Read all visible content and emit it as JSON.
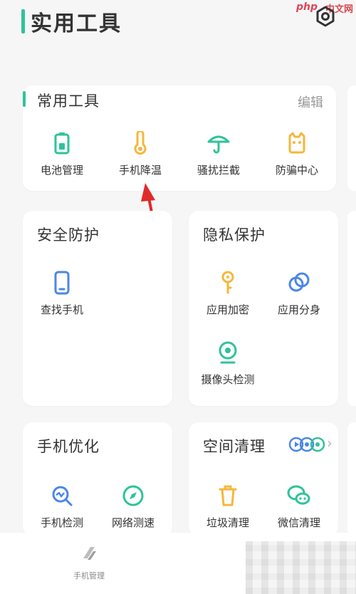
{
  "header": {
    "title": "实用工具",
    "watermark_php": "php",
    "watermark_cn": "中文网"
  },
  "common_tools": {
    "title": "常用工具",
    "edit_label": "编辑",
    "items": [
      {
        "label": "电池管理",
        "icon": "battery-icon"
      },
      {
        "label": "手机降温",
        "icon": "thermometer-icon"
      },
      {
        "label": "骚扰拦截",
        "icon": "umbrella-icon"
      },
      {
        "label": "防骗中心",
        "icon": "shield-face-icon"
      }
    ]
  },
  "security": {
    "title": "安全防护",
    "items": [
      {
        "label": "查找手机",
        "icon": "phone-icon"
      }
    ]
  },
  "privacy": {
    "title": "隐私保护",
    "items": [
      {
        "label": "应用加密",
        "icon": "key-icon"
      },
      {
        "label": "应用分身",
        "icon": "clone-icon"
      },
      {
        "label": "摄像头检测",
        "icon": "camera-icon"
      }
    ]
  },
  "optimize": {
    "title": "手机优化",
    "items": [
      {
        "label": "手机检测",
        "icon": "scan-icon"
      },
      {
        "label": "网络测速",
        "icon": "compass-icon"
      }
    ]
  },
  "space": {
    "title": "空间清理",
    "items": [
      {
        "label": "垃圾清理",
        "icon": "trash-icon"
      },
      {
        "label": "微信清理",
        "icon": "wechat-icon"
      }
    ]
  },
  "bottom_nav": {
    "items": [
      {
        "label": "手机管理",
        "icon": "phone-manager-icon"
      }
    ]
  },
  "colors": {
    "accent_green": "#2ec39a",
    "icon_blue": "#4a86e8",
    "icon_yellow": "#f5b73b",
    "annotation_red": "#e02a2a"
  }
}
